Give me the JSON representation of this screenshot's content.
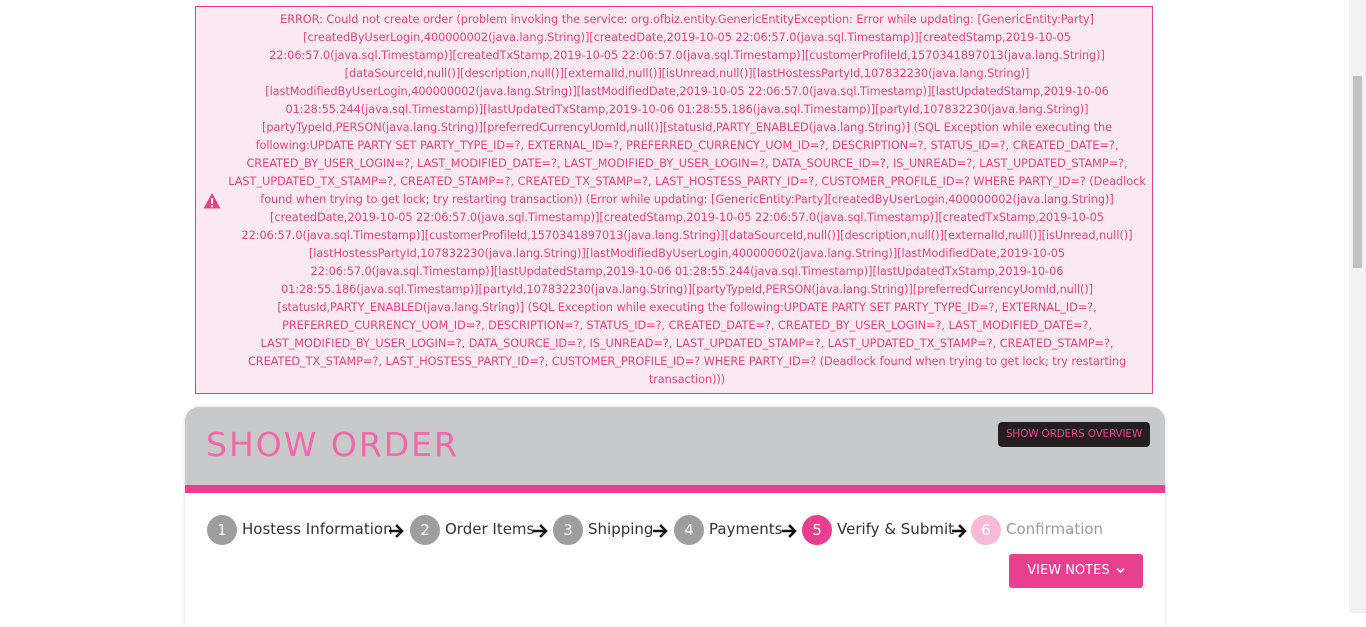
{
  "error": {
    "message": "ERROR: Could not create order (problem invoking the service: org.ofbiz.entity.GenericEntityException: Error while updating: [GenericEntity:Party][createdByUserLogin,400000002(java.lang.String)][createdDate,2019-10-05 22:06:57.0(java.sql.Timestamp)][createdStamp,2019-10-05 22:06:57.0(java.sql.Timestamp)][createdTxStamp,2019-10-05 22:06:57.0(java.sql.Timestamp)][customerProfileId,1570341897013(java.lang.String)][dataSourceId,null()][description,null()][externalId,null()][isUnread,null()][lastHostessPartyId,107832230(java.lang.String)][lastModifiedByUserLogin,400000002(java.lang.String)][lastModifiedDate,2019-10-05 22:06:57.0(java.sql.Timestamp)][lastUpdatedStamp,2019-10-06 01:28:55.244(java.sql.Timestamp)][lastUpdatedTxStamp,2019-10-06 01:28:55.186(java.sql.Timestamp)][partyId,107832230(java.lang.String)][partyTypeId,PERSON(java.lang.String)][preferredCurrencyUomId,null()][statusId,PARTY_ENABLED(java.lang.String)] (SQL Exception while executing the following:UPDATE PARTY SET PARTY_TYPE_ID=?, EXTERNAL_ID=?, PREFERRED_CURRENCY_UOM_ID=?, DESCRIPTION=?, STATUS_ID=?, CREATED_DATE=?, CREATED_BY_USER_LOGIN=?, LAST_MODIFIED_DATE=?, LAST_MODIFIED_BY_USER_LOGIN=?, DATA_SOURCE_ID=?, IS_UNREAD=?, LAST_UPDATED_STAMP=?, LAST_UPDATED_TX_STAMP=?, CREATED_STAMP=?, CREATED_TX_STAMP=?, LAST_HOSTESS_PARTY_ID=?, CUSTOMER_PROFILE_ID=? WHERE PARTY_ID=? (Deadlock found when trying to get lock; try restarting transaction)) (Error while updating: [GenericEntity:Party][createdByUserLogin,400000002(java.lang.String)][createdDate,2019-10-05 22:06:57.0(java.sql.Timestamp)][createdStamp,2019-10-05 22:06:57.0(java.sql.Timestamp)][createdTxStamp,2019-10-05 22:06:57.0(java.sql.Timestamp)][customerProfileId,1570341897013(java.lang.String)][dataSourceId,null()][description,null()][externalId,null()][isUnread,null()][lastHostessPartyId,107832230(java.lang.String)][lastModifiedByUserLogin,400000002(java.lang.String)][lastModifiedDate,2019-10-05 22:06:57.0(java.sql.Timestamp)][lastUpdatedStamp,2019-10-06 01:28:55.244(java.sql.Timestamp)][lastUpdatedTxStamp,2019-10-06 01:28:55.186(java.sql.Timestamp)][partyId,107832230(java.lang.String)][partyTypeId,PERSON(java.lang.String)][preferredCurrencyUomId,null()][statusId,PARTY_ENABLED(java.lang.String)] (SQL Exception while executing the following:UPDATE PARTY SET PARTY_TYPE_ID=?, EXTERNAL_ID=?, PREFERRED_CURRENCY_UOM_ID=?, DESCRIPTION=?, STATUS_ID=?, CREATED_DATE=?, CREATED_BY_USER_LOGIN=?, LAST_MODIFIED_DATE=?, LAST_MODIFIED_BY_USER_LOGIN=?, DATA_SOURCE_ID=?, IS_UNREAD=?, LAST_UPDATED_STAMP=?, LAST_UPDATED_TX_STAMP=?, CREATED_STAMP=?, CREATED_TX_STAMP=?, LAST_HOSTESS_PARTY_ID=?, CUSTOMER_PROFILE_ID=? WHERE PARTY_ID=? (Deadlock found when trying to get lock; try restarting transaction)))",
    "icon": "warning-icon",
    "color": "#e0457f",
    "background": "#fbe9f1"
  },
  "header": {
    "title": "SHOW ORDER",
    "overview_button": "SHOW ORDERS OVERVIEW"
  },
  "steps": [
    {
      "number": "1",
      "label": "Hostess Information",
      "state": "complete"
    },
    {
      "number": "2",
      "label": "Order Items",
      "state": "complete"
    },
    {
      "number": "3",
      "label": "Shipping",
      "state": "complete"
    },
    {
      "number": "4",
      "label": "Payments",
      "state": "complete"
    },
    {
      "number": "5",
      "label": "Verify & Submit",
      "state": "active"
    },
    {
      "number": "6",
      "label": "Confirmation",
      "state": "future"
    }
  ],
  "notes_button": {
    "label": "VIEW NOTES",
    "icon": "chevron-down-icon"
  },
  "colors": {
    "accent": "#e93f8f",
    "header_bg": "#c8c9cb",
    "dark_button": "#231f20"
  }
}
